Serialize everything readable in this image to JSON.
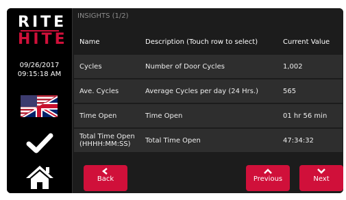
{
  "sidebar": {
    "logo_top": "RITE",
    "logo_bottom": "HITE",
    "date": "09/26/2017",
    "time": "09:15:18 AM",
    "icons": {
      "flag": "language-flag-icon",
      "check": "checkmark-icon",
      "home": "home-icon"
    }
  },
  "panel": {
    "title": "INSIGHTS (1/2)",
    "columns": [
      "Name",
      "Description (Touch row to select)",
      "Current Value"
    ],
    "rows": [
      {
        "name": "Cycles",
        "description": "Number of Door Cycles",
        "value": "1,002"
      },
      {
        "name": "Ave. Cycles",
        "description": "Average Cycles per day (24 Hrs.)",
        "value": "565"
      },
      {
        "name": "Time Open",
        "description": "Time Open",
        "value": "01 hr 56 min"
      },
      {
        "name": "Total Time Open (HHHH:MM:SS)",
        "description": "Total Time Open",
        "value": "47:34:32"
      }
    ]
  },
  "buttons": {
    "back": "Back",
    "previous": "Previous",
    "next": "Next"
  },
  "colors": {
    "accent": "#d0103a",
    "background": "#000000",
    "panel": "#1c1c1c",
    "row": "#2e2e2e"
  }
}
